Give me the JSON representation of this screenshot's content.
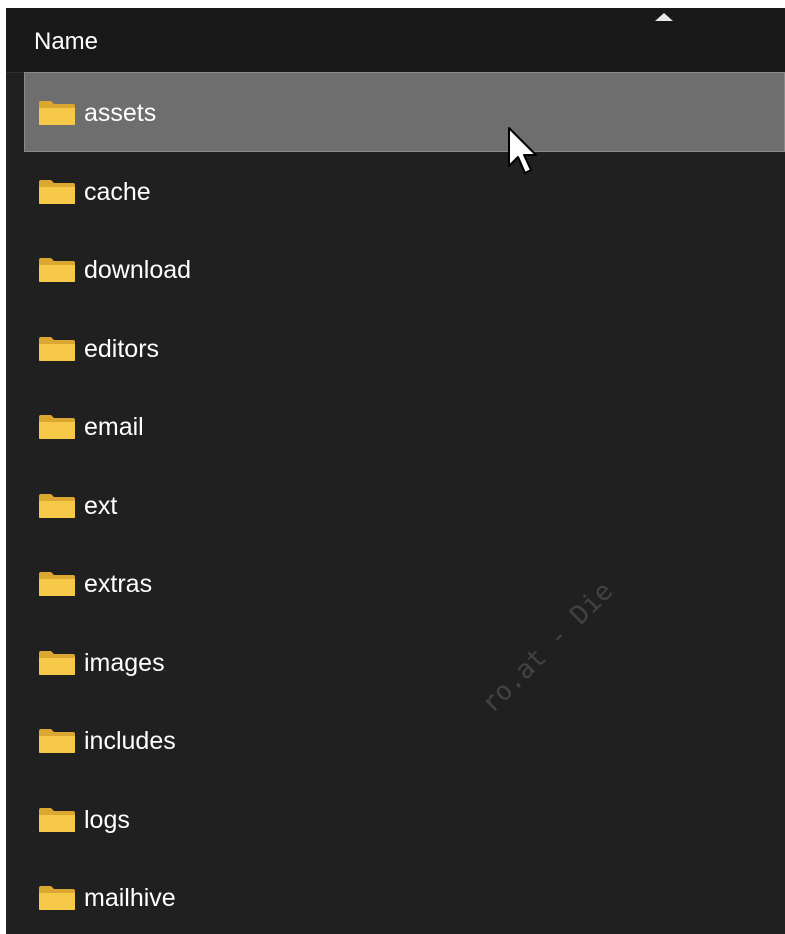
{
  "header": {
    "column_label": "Name",
    "sort_direction": "ascending"
  },
  "folders": [
    {
      "name": "assets",
      "icon": "folder-icon",
      "selected": true
    },
    {
      "name": "cache",
      "icon": "folder-icon",
      "selected": false
    },
    {
      "name": "download",
      "icon": "folder-icon",
      "selected": false
    },
    {
      "name": "editors",
      "icon": "folder-icon",
      "selected": false
    },
    {
      "name": "email",
      "icon": "folder-icon",
      "selected": false
    },
    {
      "name": "ext",
      "icon": "folder-icon",
      "selected": false
    },
    {
      "name": "extras",
      "icon": "folder-icon",
      "selected": false
    },
    {
      "name": "images",
      "icon": "folder-icon",
      "selected": false
    },
    {
      "name": "includes",
      "icon": "folder-icon",
      "selected": false
    },
    {
      "name": "logs",
      "icon": "folder-icon",
      "selected": false
    },
    {
      "name": "mailhive",
      "icon": "folder-icon",
      "selected": false
    }
  ],
  "watermark": "ro.at - Die",
  "colors": {
    "background": "#202020",
    "selection": "#6e6e6e",
    "folder_yellow": "#f5c441",
    "text": "#ffffff"
  }
}
